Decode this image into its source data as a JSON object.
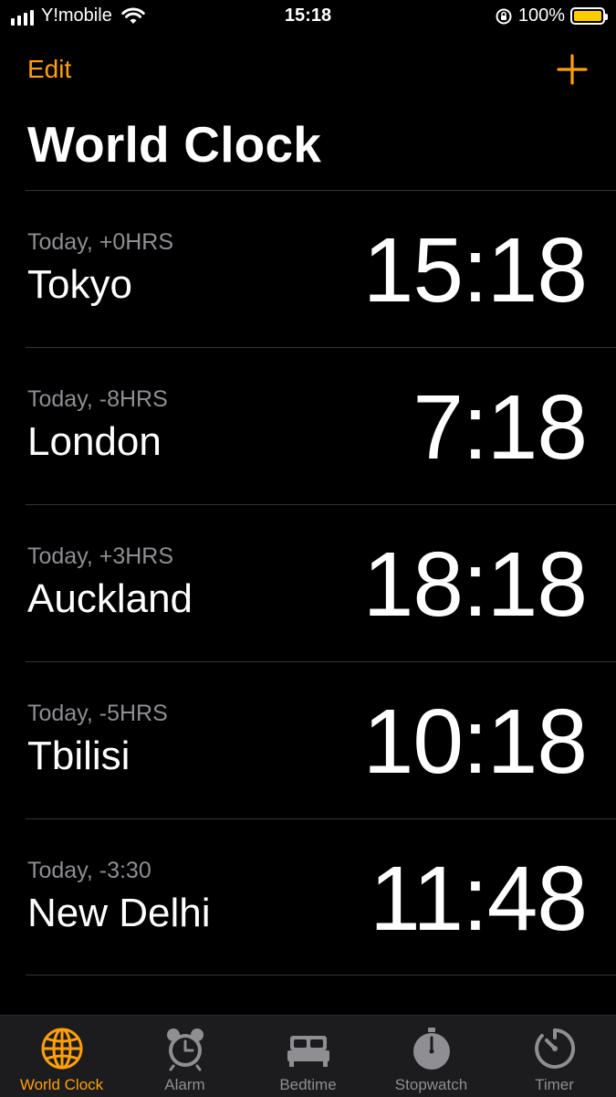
{
  "status_bar": {
    "carrier": "Y!mobile",
    "time": "15:18",
    "battery_percent": "100%",
    "battery_level": 1.0,
    "signal_bars": 4
  },
  "nav": {
    "edit_label": "Edit",
    "add_icon": "plus-icon",
    "title": "World Clock"
  },
  "clocks": [
    {
      "offset": "Today, +0HRS",
      "city": "Tokyo",
      "time": "15:18"
    },
    {
      "offset": "Today, -8HRS",
      "city": "London",
      "time": "7:18"
    },
    {
      "offset": "Today, +3HRS",
      "city": "Auckland",
      "time": "18:18"
    },
    {
      "offset": "Today, -5HRS",
      "city": "Tbilisi",
      "time": "10:18"
    },
    {
      "offset": "Today, -3:30",
      "city": "New Delhi",
      "time": "11:48"
    }
  ],
  "tabs": [
    {
      "label": "World Clock",
      "icon": "globe-icon",
      "active": true
    },
    {
      "label": "Alarm",
      "icon": "alarm-clock-icon",
      "active": false
    },
    {
      "label": "Bedtime",
      "icon": "bed-icon",
      "active": false
    },
    {
      "label": "Stopwatch",
      "icon": "stopwatch-icon",
      "active": false
    },
    {
      "label": "Timer",
      "icon": "timer-icon",
      "active": false
    }
  ],
  "colors": {
    "accent": "#ff9f0a",
    "background": "#000000",
    "secondary_text": "#8e8e93",
    "tab_bar": "#1c1c1e",
    "battery": "#ffcc00"
  }
}
